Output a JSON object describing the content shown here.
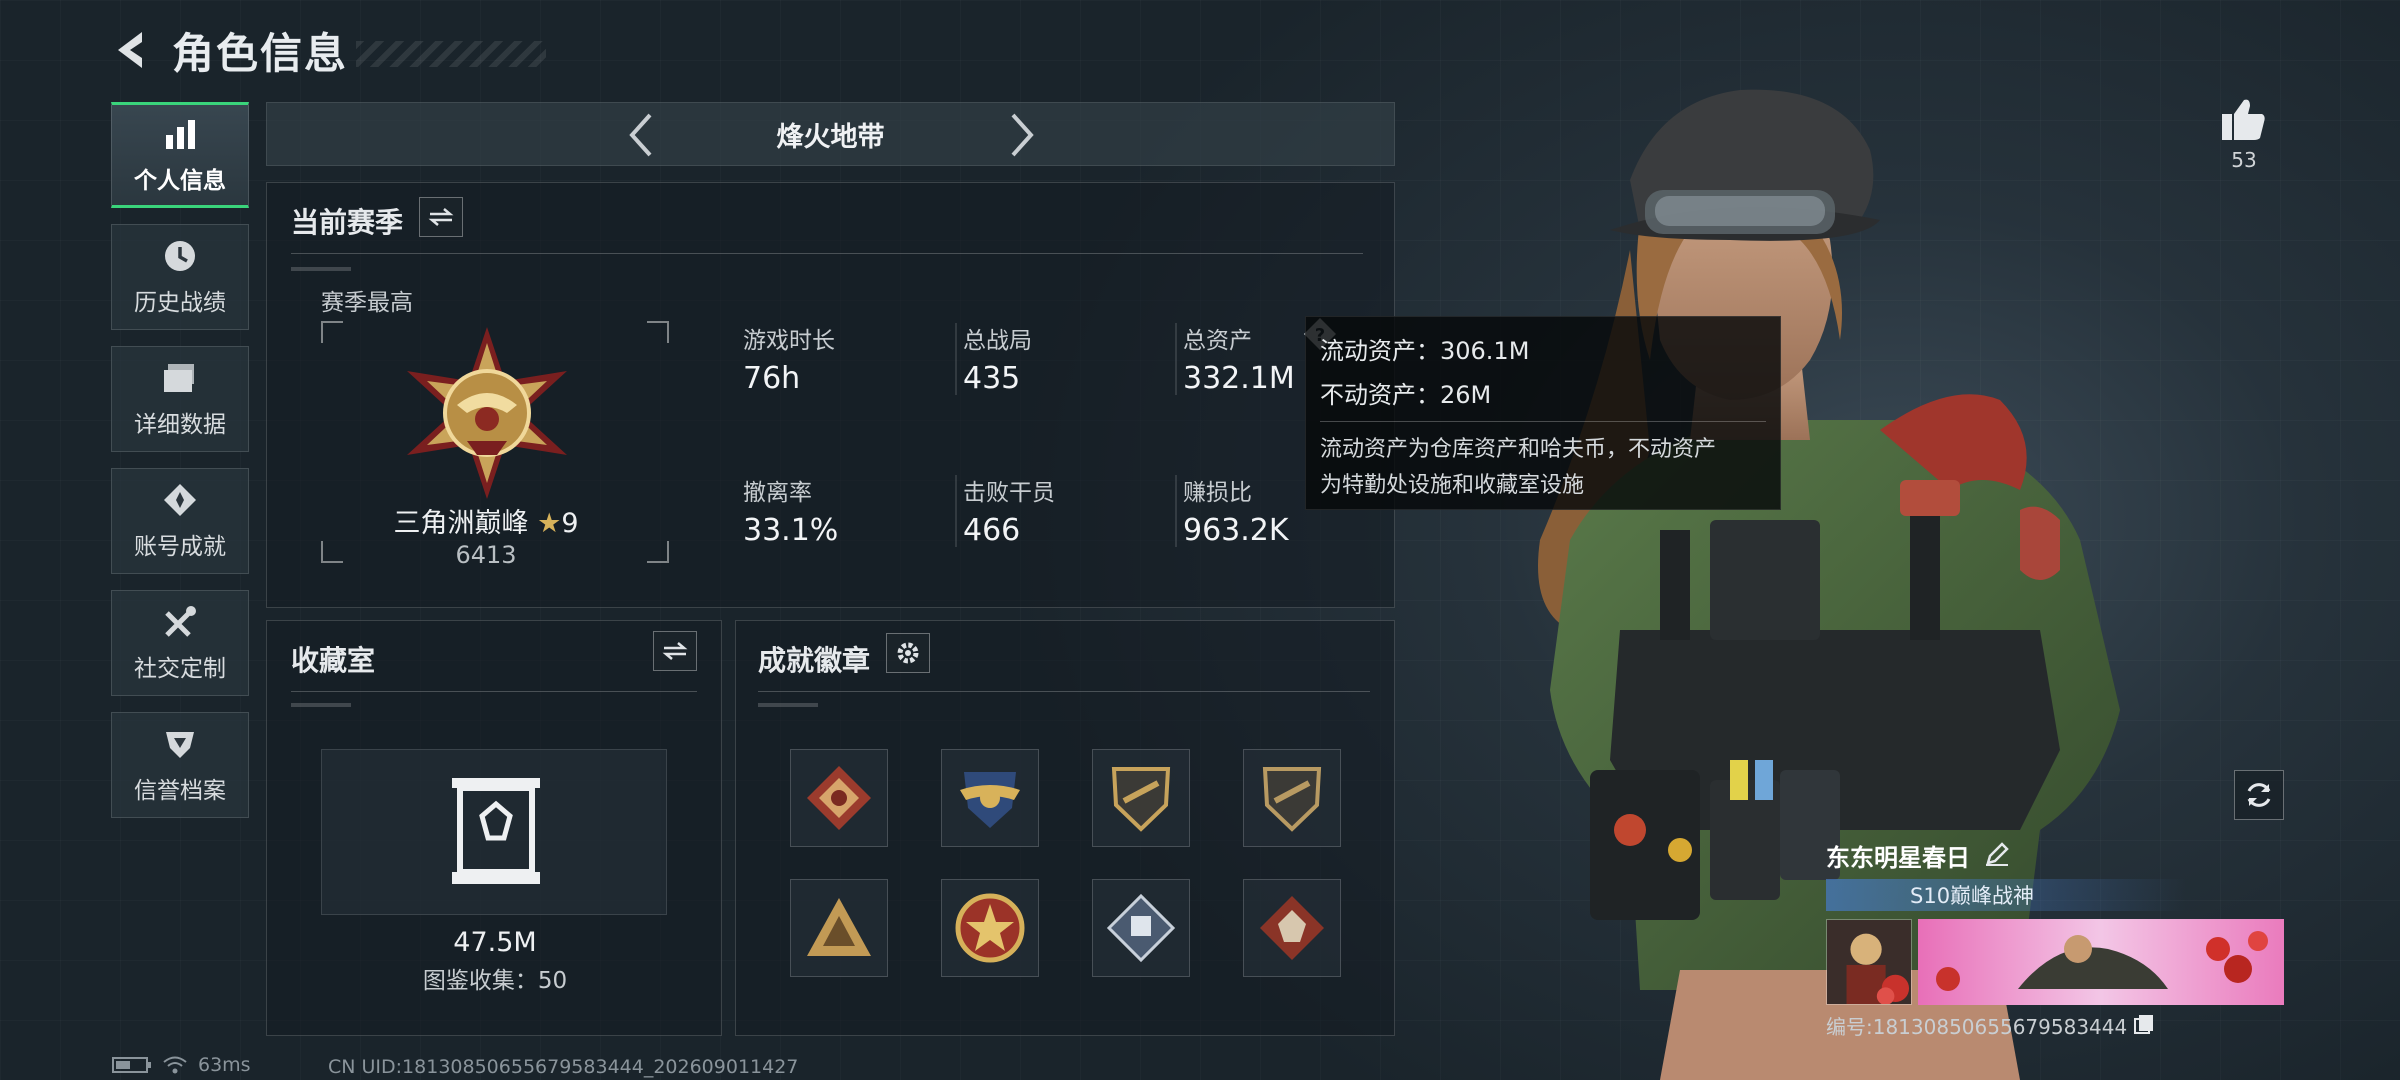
{
  "header": {
    "title": "角色信息"
  },
  "sidebar": {
    "items": [
      {
        "label": "个人信息",
        "icon": "bar-chart-icon",
        "active": true
      },
      {
        "label": "历史战绩",
        "icon": "history-icon"
      },
      {
        "label": "详细数据",
        "icon": "folder-icon"
      },
      {
        "label": "账号成就",
        "icon": "achievement-icon"
      },
      {
        "label": "社交定制",
        "icon": "tools-icon"
      },
      {
        "label": "信誉档案",
        "icon": "shield-icon"
      }
    ]
  },
  "mode": {
    "title": "烽火地带"
  },
  "season": {
    "title": "当前赛季",
    "highest_label": "赛季最高",
    "rank_name": "三角洲巅峰",
    "rank_stars": "9",
    "rank_score": "6413",
    "stats": [
      {
        "label": "游戏时长",
        "value": "76h"
      },
      {
        "label": "总战局",
        "value": "435"
      },
      {
        "label": "总资产",
        "value": "332.1M"
      },
      {
        "label": "撤离率",
        "value": "33.1%"
      },
      {
        "label": "击败干员",
        "value": "466"
      },
      {
        "label": "赚损比",
        "value": "963.2K"
      }
    ]
  },
  "tooltip": {
    "liquid": "流动资产：306.1M",
    "fixed": "不动资产：26M",
    "desc_line1": "流动资产为仓库资产和哈夫币，不动资产",
    "desc_line2": "为特勤处设施和收藏室设施"
  },
  "collection": {
    "title": "收藏室",
    "value": "47.5M",
    "catalog": "图鉴收集：50"
  },
  "badges": {
    "title": "成就徽章",
    "items": [
      "dragon-badge-icon",
      "eagle-crest-badge-icon",
      "rifle-shield-badge-icon",
      "rifle-shield-badge-icon-2",
      "triangle-badge-icon",
      "star-medal-badge-icon",
      "diamond-badge-icon",
      "wolf-badge-icon"
    ]
  },
  "social": {
    "likes": "53"
  },
  "profile": {
    "name": "东东明星春日",
    "title_tag": "S10巅峰战神",
    "id_line": "编号:18130850655679583444"
  },
  "footer": {
    "ping": "63ms",
    "uid": "CN UID:18130850655679583444_202609011427"
  },
  "colors": {
    "accent": "#3ad47b",
    "gold": "#c9a45a",
    "panel_border": "#3a464e"
  }
}
